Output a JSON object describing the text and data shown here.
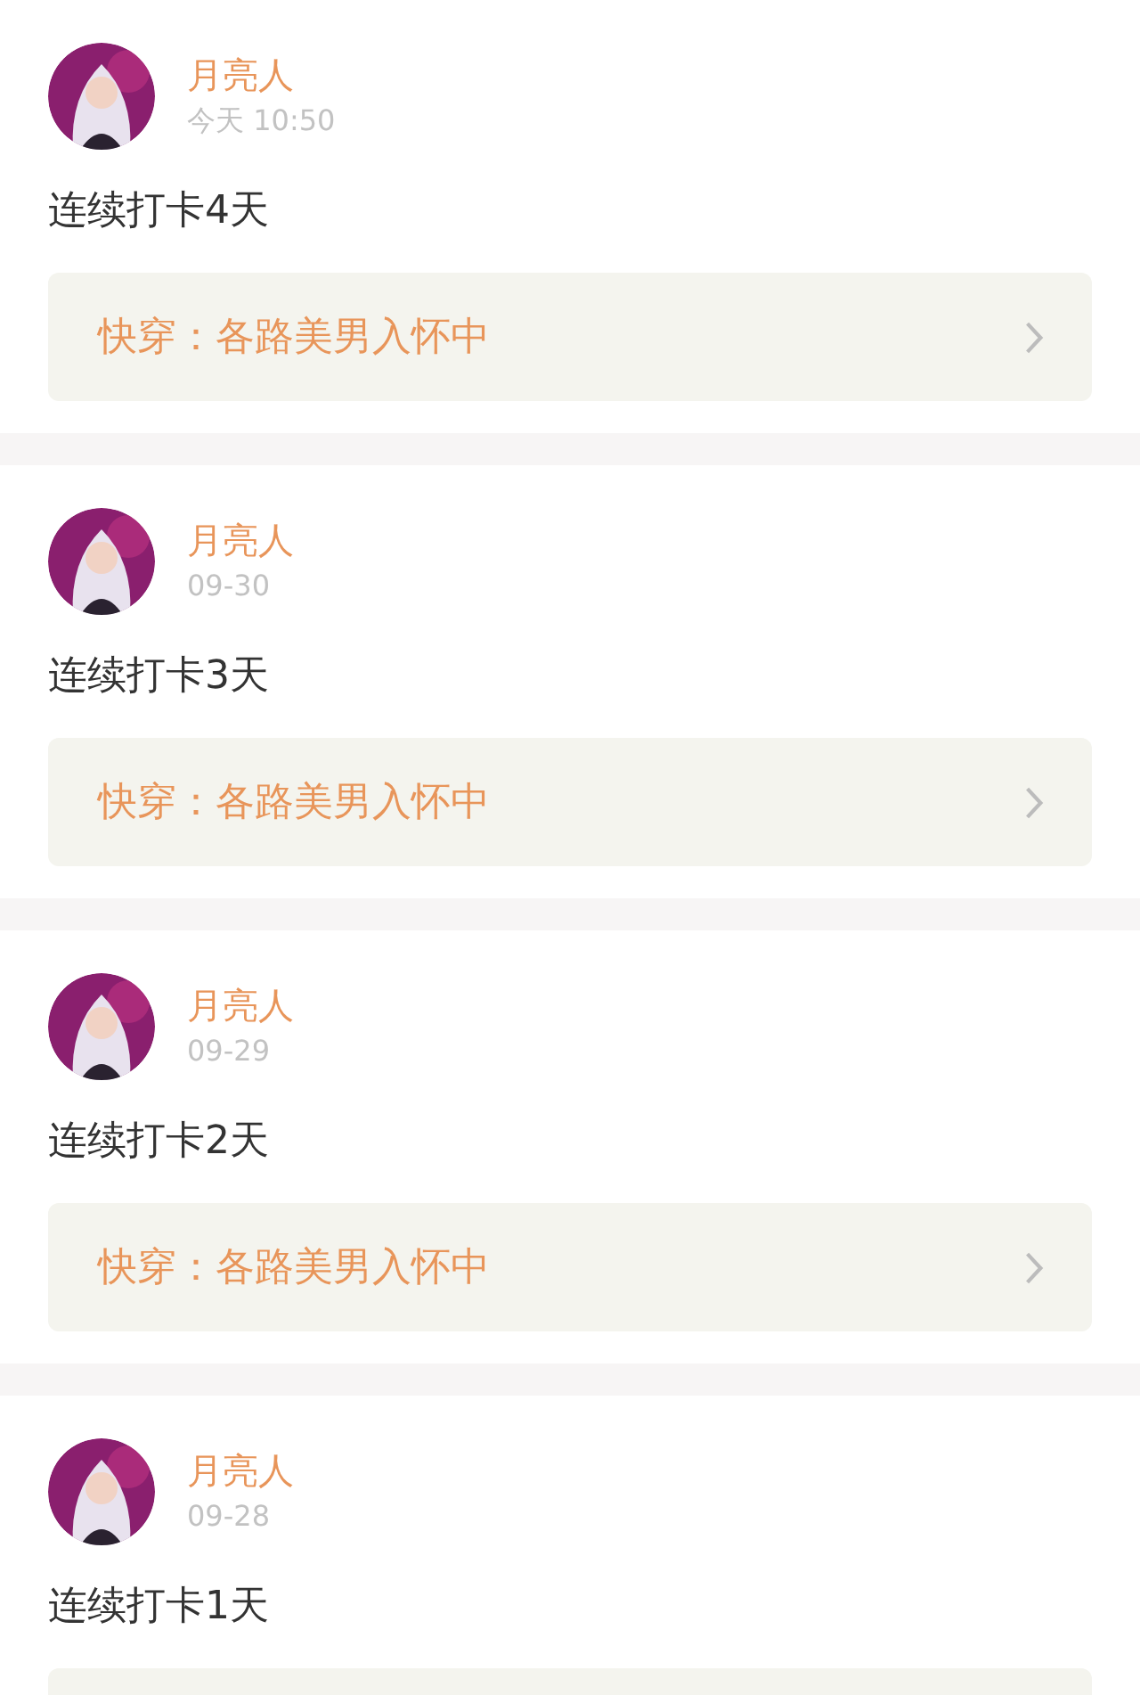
{
  "posts": [
    {
      "author": "月亮人",
      "time": "今天 10:50",
      "text": "连续打卡4天",
      "book": {
        "kind": "full",
        "title": "快穿：各路美男入怀中"
      }
    },
    {
      "author": "月亮人",
      "time": "09-30",
      "text": "连续打卡3天",
      "book": {
        "kind": "full",
        "title": "快穿：各路美男入怀中"
      }
    },
    {
      "author": "月亮人",
      "time": "09-29",
      "text": "连续打卡2天",
      "book": {
        "kind": "full",
        "title": "快穿：各路美男入怀中"
      }
    },
    {
      "author": "月亮人",
      "time": "09-28",
      "text": "连续打卡1天",
      "book": {
        "kind": "partial"
      }
    }
  ]
}
